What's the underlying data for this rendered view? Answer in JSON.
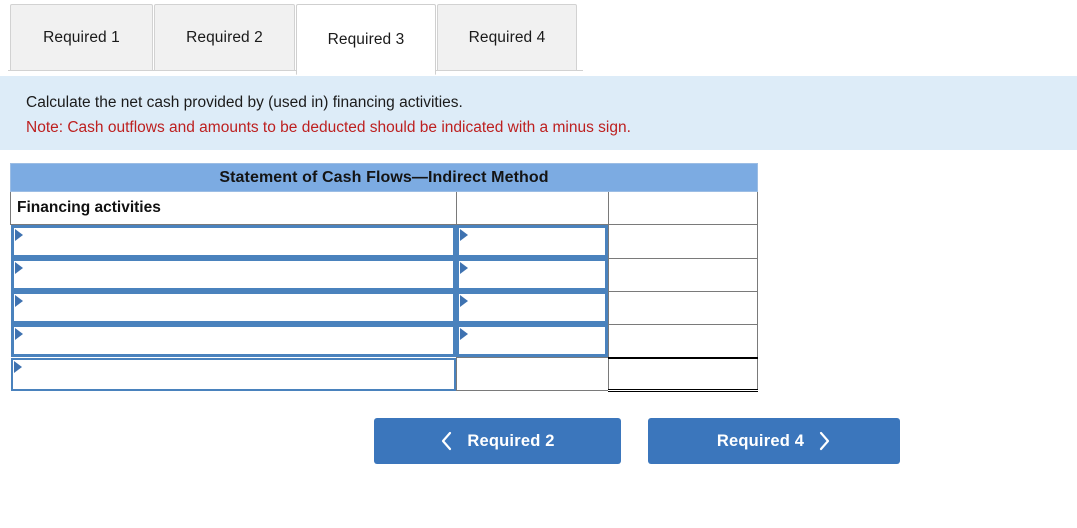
{
  "tabs": [
    {
      "label": "Required 1",
      "active": false
    },
    {
      "label": "Required 2",
      "active": false
    },
    {
      "label": "Required 3",
      "active": true
    },
    {
      "label": "Required 4",
      "active": false
    }
  ],
  "instructions": {
    "prompt": "Calculate the net cash provided by (used in) financing activities.",
    "note": "Note: Cash outflows and amounts to be deducted should be indicated with a minus sign."
  },
  "statement": {
    "title": "Statement of Cash Flows—Indirect Method",
    "section_label": "Financing activities",
    "rows": [
      {
        "description": "",
        "amount": "",
        "total": ""
      },
      {
        "description": "",
        "amount": "",
        "total": ""
      },
      {
        "description": "",
        "amount": "",
        "total": ""
      },
      {
        "description": "",
        "amount": "",
        "total": ""
      },
      {
        "description": "",
        "amount": "",
        "total": ""
      }
    ]
  },
  "navigation": {
    "prev_label": "Required 2",
    "next_label": "Required 4",
    "prev_icon": "chevron-left-icon",
    "next_icon": "chevron-right-icon"
  },
  "colors": {
    "button_blue": "#3b76bc",
    "table_header_blue": "#7cabe2",
    "banner_blue": "#ddecf8",
    "note_red": "#bd2020",
    "input_border_blue": "#4a82bd",
    "marker_blue": "#3e72b0"
  }
}
